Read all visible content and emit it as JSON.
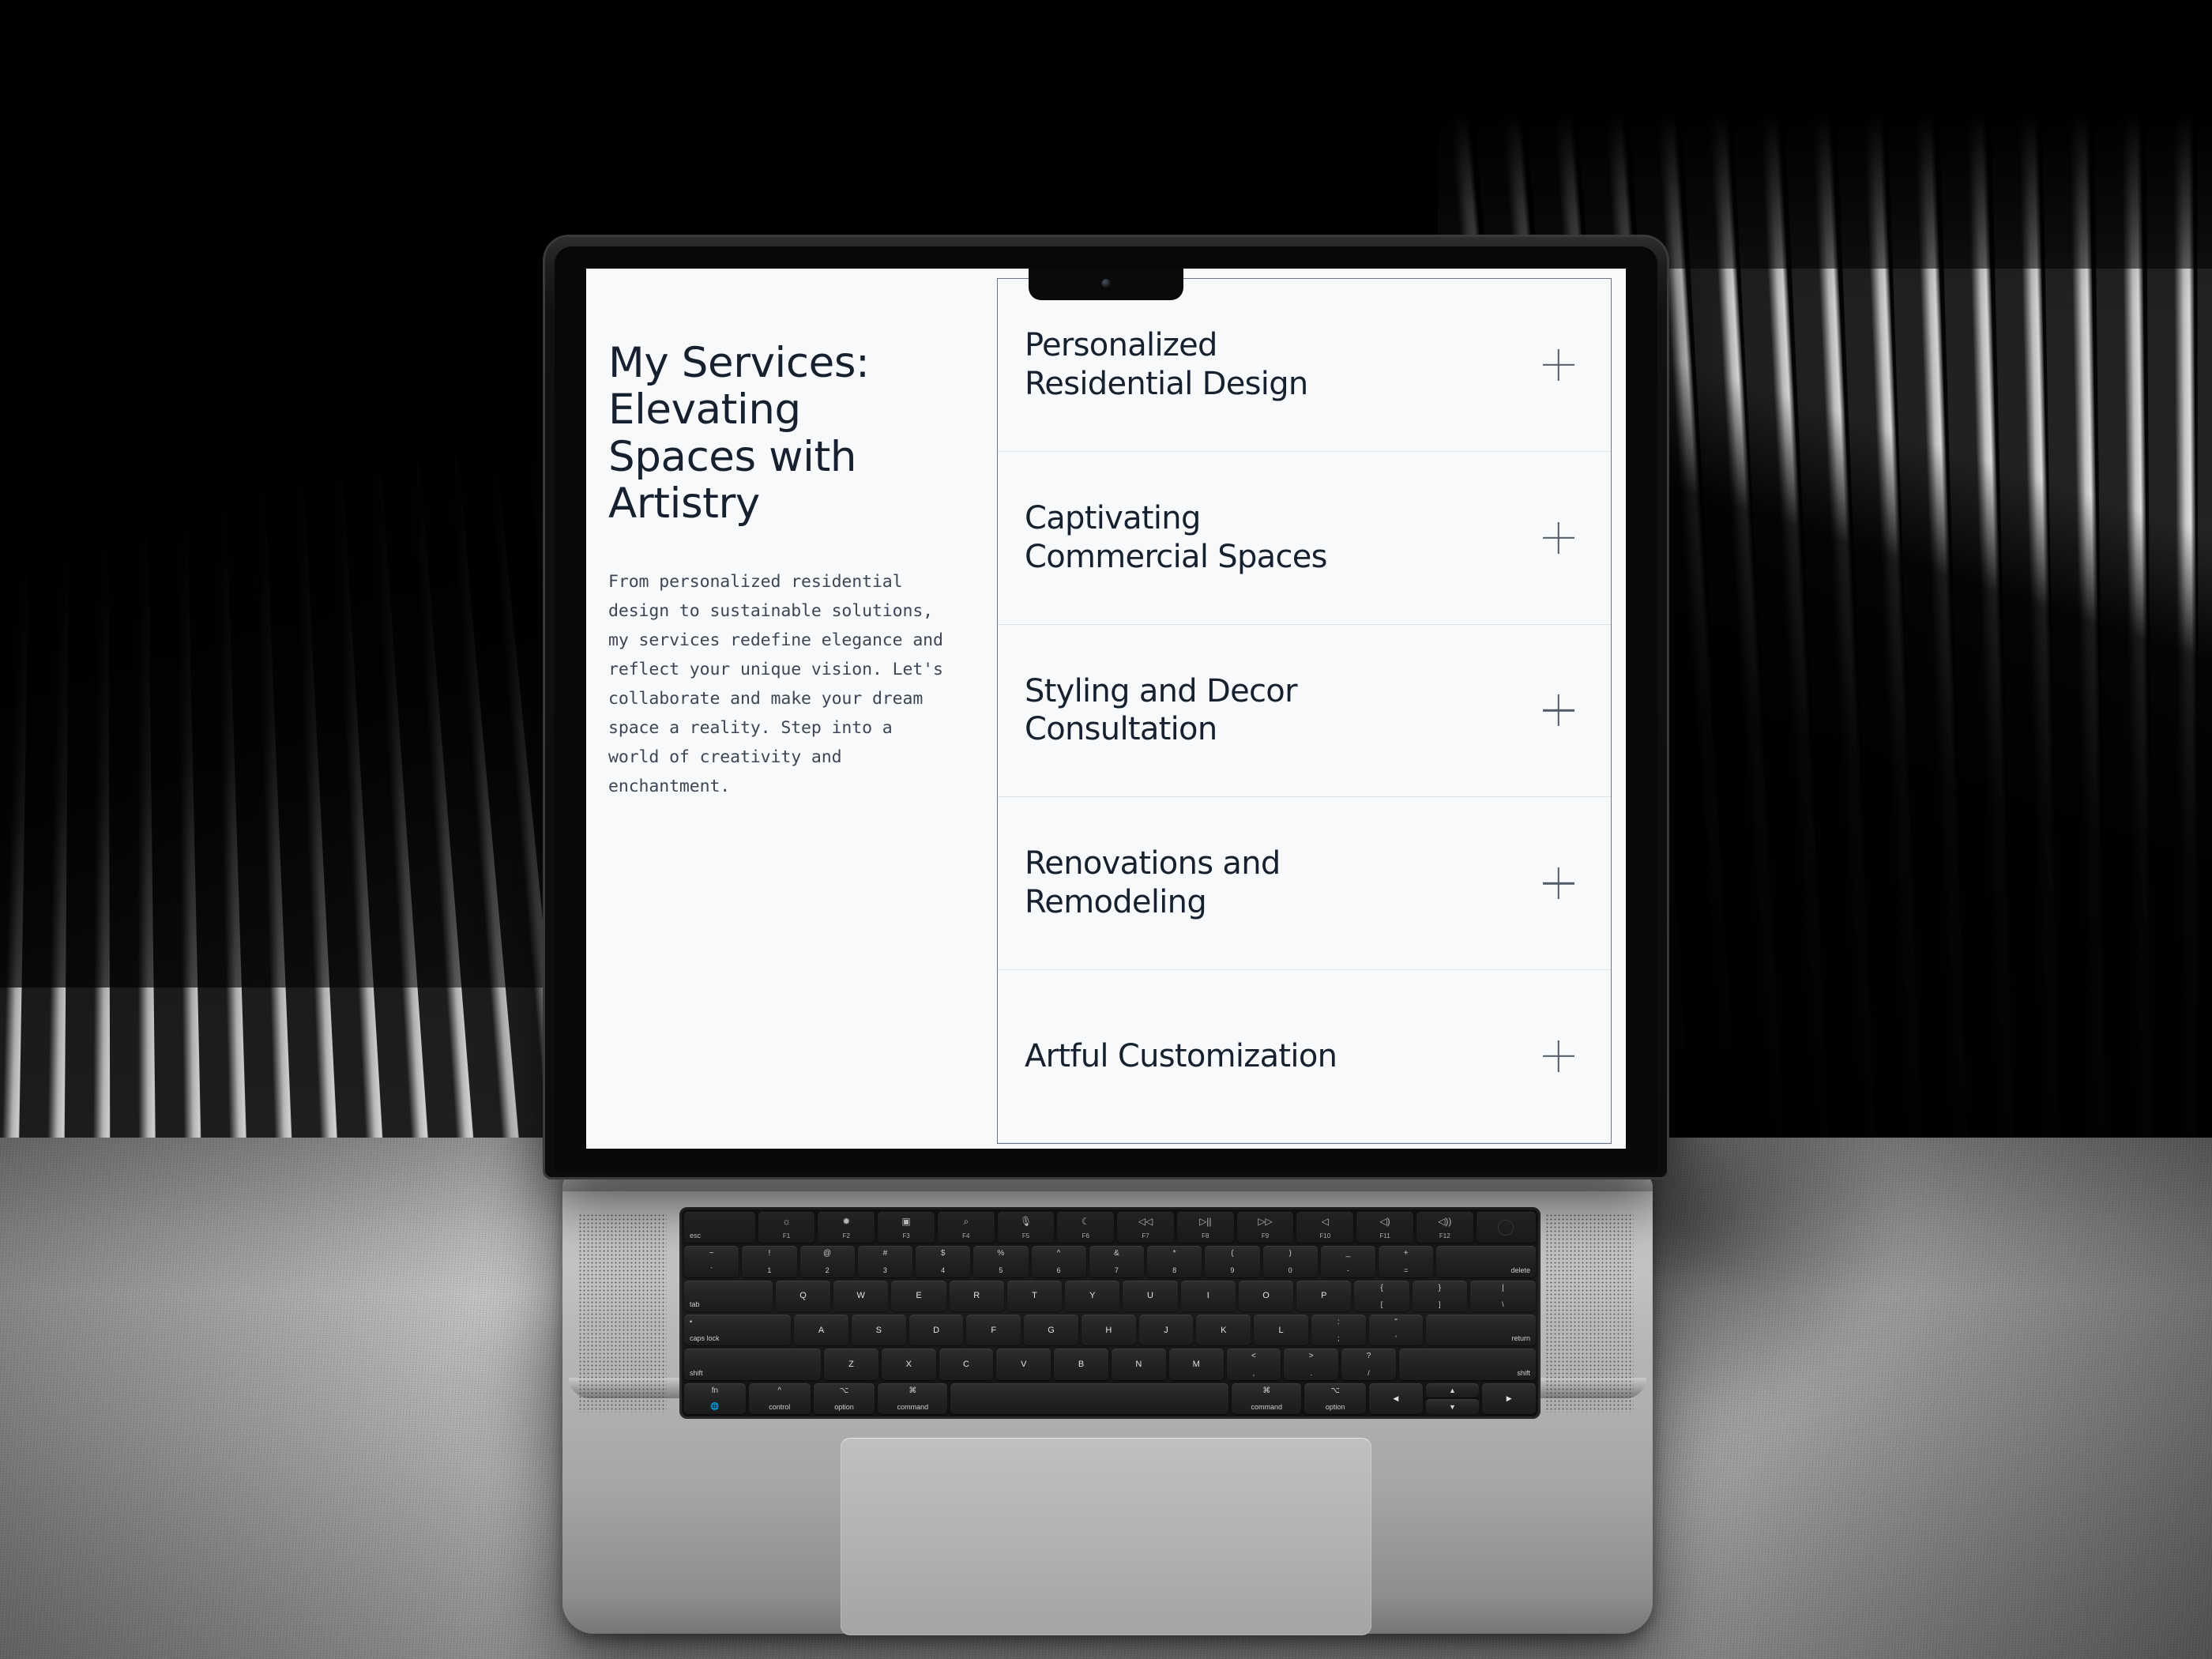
{
  "site": {
    "heading": "My Services: Elevating Spaces with Artistry",
    "body": "From personalized residential design to sustainable solutions, my services redefine elegance and reflect your unique vision. Let's collaborate and make your dream space a reality. Step into a world of creativity and enchantment.",
    "accordion": [
      {
        "label": "Personalized Residential Design",
        "toggle_icon": "plus-icon"
      },
      {
        "label": "Captivating Commercial Spaces",
        "toggle_icon": "plus-icon"
      },
      {
        "label": "Styling and Decor Consultation",
        "toggle_icon": "plus-icon"
      },
      {
        "label": "Renovations and Remodeling",
        "toggle_icon": "plus-icon"
      },
      {
        "label": "Artful Customization",
        "toggle_icon": "plus-icon"
      }
    ],
    "colors": {
      "screen_bg": "#f7f9fb",
      "text": "#16202e",
      "muted_text": "#3c4654",
      "panel_border": "#6a7585",
      "row_divider": "#dfe3e8"
    }
  },
  "device": {
    "kind": "laptop",
    "notch_icon": "camera-icon",
    "keyboard": {
      "fn_row": [
        {
          "label": "esc",
          "glyph": "",
          "align": "left"
        },
        {
          "label": "F1",
          "glyph": "☼"
        },
        {
          "label": "F2",
          "glyph": "✹"
        },
        {
          "label": "F3",
          "glyph": "▣"
        },
        {
          "label": "F4",
          "glyph": "⌕"
        },
        {
          "label": "F5",
          "glyph": "🎙"
        },
        {
          "label": "F6",
          "glyph": "☾"
        },
        {
          "label": "F7",
          "glyph": "◁◁"
        },
        {
          "label": "F8",
          "glyph": "▷||"
        },
        {
          "label": "F9",
          "glyph": "▷▷"
        },
        {
          "label": "F10",
          "glyph": "◁"
        },
        {
          "label": "F11",
          "glyph": "◁)"
        },
        {
          "label": "F12",
          "glyph": "◁))"
        },
        {
          "label": "",
          "glyph": "power-icon"
        }
      ],
      "number_row": [
        {
          "top": "~",
          "bottom": "`"
        },
        {
          "top": "!",
          "bottom": "1"
        },
        {
          "top": "@",
          "bottom": "2"
        },
        {
          "top": "#",
          "bottom": "3"
        },
        {
          "top": "$",
          "bottom": "4"
        },
        {
          "top": "%",
          "bottom": "5"
        },
        {
          "top": "^",
          "bottom": "6"
        },
        {
          "top": "&",
          "bottom": "7"
        },
        {
          "top": "*",
          "bottom": "8"
        },
        {
          "top": "(",
          "bottom": "9"
        },
        {
          "top": ")",
          "bottom": "0"
        },
        {
          "top": "_",
          "bottom": "-"
        },
        {
          "top": "+",
          "bottom": "="
        },
        {
          "top": "",
          "bottom": "delete"
        }
      ],
      "q_row": [
        "tab",
        "Q",
        "W",
        "E",
        "R",
        "T",
        "Y",
        "U",
        "I",
        "O",
        "P",
        "[",
        "]",
        "\\"
      ],
      "a_row": [
        "caps lock",
        "A",
        "S",
        "D",
        "F",
        "G",
        "H",
        "J",
        "K",
        "L",
        ";",
        "'",
        "return"
      ],
      "z_row": [
        "shift",
        "Z",
        "X",
        "C",
        "V",
        "B",
        "N",
        "M",
        ",",
        ".",
        "/",
        "shift"
      ],
      "bottom_row": [
        "fn",
        "control",
        "option",
        "command",
        "",
        "command",
        "option",
        "◀",
        "▲ ▼",
        "▶"
      ]
    }
  }
}
